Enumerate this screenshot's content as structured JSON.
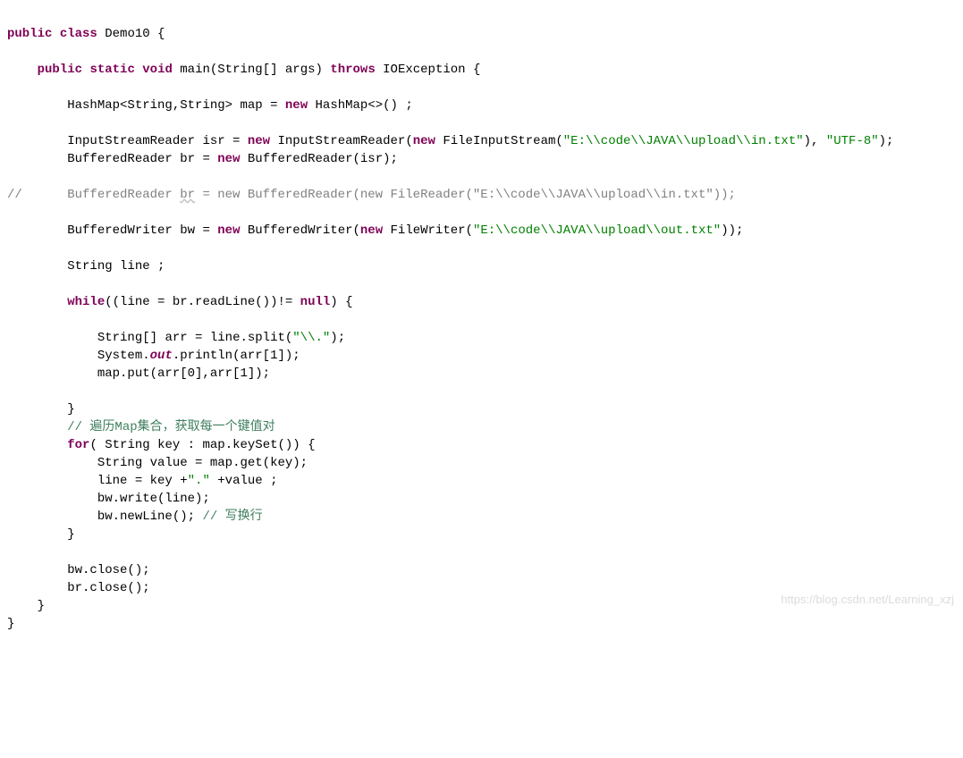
{
  "watermark": "https://blog.csdn.net/Learning_xzj",
  "lines": {
    "0": {
      "t0": "public",
      "t1": " ",
      "t2": "class",
      "t3": " Demo10 {"
    },
    "1": {
      "t0": ""
    },
    "2": {
      "t0": "    ",
      "t1": "public",
      "t2": " ",
      "t3": "static",
      "t4": " ",
      "t5": "void",
      "t6": " main(String[] args) ",
      "t7": "throws",
      "t8": " IOException {"
    },
    "3": {
      "t0": ""
    },
    "4": {
      "t0": "        HashMap<String,String> ",
      "t1": "map",
      "t2": " = ",
      "t3": "new",
      "t4": " HashMap<>() ;"
    },
    "5": {
      "t0": ""
    },
    "6": {
      "t0": "        InputStreamReader ",
      "t1": "isr",
      "t2": " = ",
      "t3": "new",
      "t4": " InputStreamReader(",
      "t5": "new",
      "t6": " FileInputStream(",
      "t7": "\"E:\\\\code\\\\JAVA\\\\upload\\\\in.txt\"",
      "t8": "), ",
      "t9": "\"UTF-8\"",
      "t10": ");"
    },
    "7": {
      "t0": "        BufferedReader ",
      "t1": "br",
      "t2": " = ",
      "t3": "new",
      "t4": " BufferedReader(isr);"
    },
    "8": {
      "t0": ""
    },
    "9": {
      "t0": "//      BufferedReader ",
      "t1": "br",
      "t2": " = new BufferedReader(new FileReader(\"E:\\\\code\\\\JAVA\\\\upload\\\\in.txt\"));"
    },
    "10": {
      "t0": ""
    },
    "11": {
      "t0": "        BufferedWriter ",
      "t1": "bw",
      "t2": " = ",
      "t3": "new",
      "t4": " BufferedWriter(",
      "t5": "new",
      "t6": " FileWriter(",
      "t7": "\"E:\\\\code\\\\JAVA\\\\upload\\\\out.txt\"",
      "t8": "));"
    },
    "12": {
      "t0": ""
    },
    "13": {
      "t0": "        String ",
      "t1": "line",
      "t2": " ;"
    },
    "14": {
      "t0": ""
    },
    "15": {
      "t0": "        ",
      "t1": "while",
      "t2": "((line = br.readLine())!= ",
      "t3": "null",
      "t4": ") {"
    },
    "16": {
      "t0": ""
    },
    "17": {
      "t0": "            String[] ",
      "t1": "arr",
      "t2": " = line.split(",
      "t3": "\"\\\\.\"",
      "t4": ");"
    },
    "18": {
      "t0": "            System.",
      "t1": "out",
      "t2": ".println(arr[1]);"
    },
    "19": {
      "t0": "            map.put(arr[0],arr[1]);"
    },
    "20": {
      "t0": ""
    },
    "21": {
      "t0": "        }"
    },
    "22": {
      "t0": "        ",
      "t1": "// 遍历Map集合，获取每一个键值对"
    },
    "23": {
      "t0": "        ",
      "t1": "for",
      "t2": "( String ",
      "t3": "key",
      "t4": " : map.keySet()) {"
    },
    "24": {
      "t0": "            String ",
      "t1": "value",
      "t2": " = map.get(key);"
    },
    "25": {
      "t0": "            line = key +",
      "t1": "\".\"",
      "t2": " +value ;"
    },
    "26": {
      "t0": "            bw.write(line);"
    },
    "27": {
      "t0": "            bw.newLine(); ",
      "t1": "// 写换行"
    },
    "28": {
      "t0": "        }"
    },
    "29": {
      "t0": ""
    },
    "30": {
      "t0": "        bw.close();"
    },
    "31": {
      "t0": "        br.close();"
    },
    "32": {
      "t0": "    }"
    },
    "33": {
      "t0": "}"
    }
  }
}
